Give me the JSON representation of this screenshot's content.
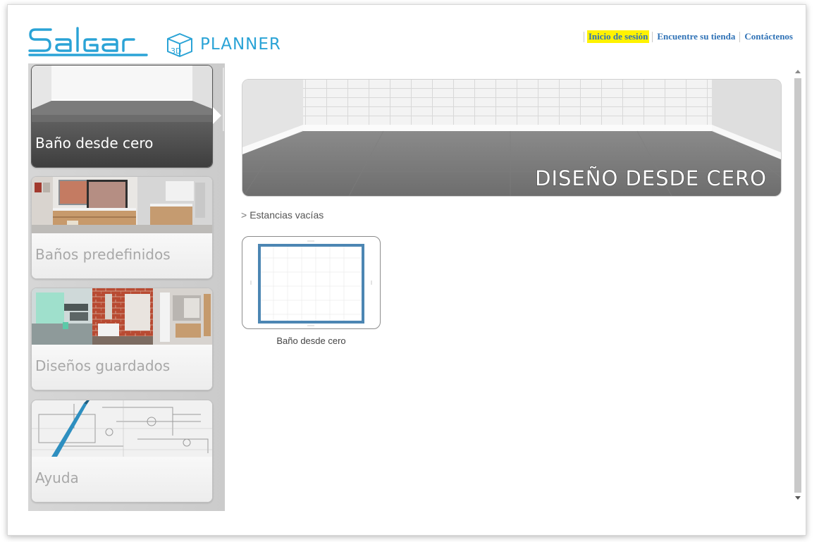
{
  "app": {
    "logo_brand": "Salgar",
    "logo_product": "PLANNER",
    "logo_cube_text": "3D"
  },
  "colors": {
    "brand_blue": "#2aa3d6",
    "nav_link": "#2f72b6",
    "highlight": "#fff200",
    "active_card": "#4a4a4a",
    "plan_border": "#4c86b3"
  },
  "top_nav": {
    "login": "Inicio de sesión",
    "find_store": "Encuentre su tienda",
    "contact": "Contáctenos"
  },
  "sidebar": {
    "items": [
      {
        "label": "Baño desde cero",
        "active": true,
        "thumb_icon": "empty-room-thumbnail"
      },
      {
        "label": "Baños predefinidos",
        "active": false,
        "thumb_icon": "bathroom-furniture-thumbnail"
      },
      {
        "label": "Diseños guardados",
        "active": false,
        "thumb_icon": "saved-bathrooms-thumbnail"
      },
      {
        "label": "Ayuda",
        "active": false,
        "thumb_icon": "blueprint-pen-thumbnail"
      }
    ]
  },
  "main": {
    "banner_title": "DISEÑO DESDE CERO",
    "breadcrumb_sep": ">",
    "breadcrumb": "Estancias vacías",
    "tiles": [
      {
        "caption": "Baño desde cero",
        "icon": "floor-plan-icon"
      }
    ]
  }
}
